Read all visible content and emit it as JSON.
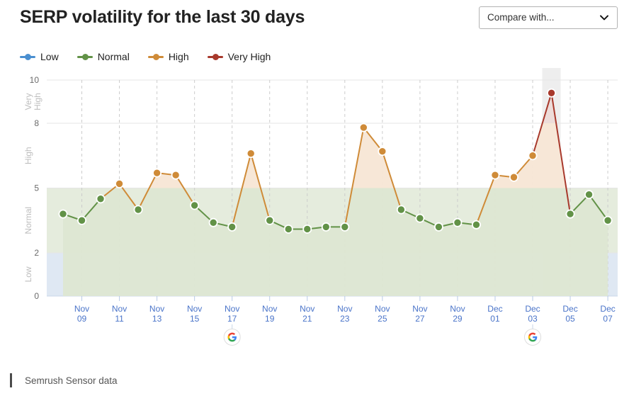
{
  "header": {
    "title": "SERP volatility for the last 30 days",
    "compare_placeholder": "Compare with...",
    "chevron_icon": "chevron-down-icon"
  },
  "legend": {
    "items": [
      {
        "label": "Low",
        "color": "#4a8fd0"
      },
      {
        "label": "Normal",
        "color": "#629247"
      },
      {
        "label": "High",
        "color": "#cf8b38"
      },
      {
        "label": "Very High",
        "color": "#a8392c"
      }
    ]
  },
  "footer": {
    "source_text": "Semrush Sensor data"
  },
  "chart_data": {
    "type": "line",
    "title": "SERP volatility for the last 30 days",
    "xlabel": "",
    "ylabel": "",
    "ylim": [
      0,
      10
    ],
    "yticks": [
      0,
      2,
      5,
      8,
      10
    ],
    "grid": true,
    "legend_position": "top-left",
    "bands": [
      {
        "name": "Low",
        "from": 0,
        "to": 2,
        "label": "Low",
        "fill": "#dbe6f2"
      },
      {
        "name": "Normal",
        "from": 2,
        "to": 5,
        "label": "Normal",
        "fill": "#e2ead9"
      },
      {
        "name": "High",
        "from": 5,
        "to": 8,
        "label": "High",
        "fill": "#ffffff"
      },
      {
        "name": "Very High",
        "from": 8,
        "to": 10,
        "label": "Very High",
        "fill": "#ffffff"
      }
    ],
    "xtick_labels": [
      "Nov 09",
      "Nov 11",
      "Nov 13",
      "Nov 15",
      "Nov 17",
      "Nov 19",
      "Nov 21",
      "Nov 23",
      "Nov 25",
      "Nov 27",
      "Nov 29",
      "Dec 01",
      "Dec 03",
      "Dec 05",
      "Dec 07"
    ],
    "x": [
      "Nov 08",
      "Nov 09",
      "Nov 10",
      "Nov 11",
      "Nov 12",
      "Nov 13",
      "Nov 14",
      "Nov 15",
      "Nov 16",
      "Nov 17",
      "Nov 18",
      "Nov 19",
      "Nov 20",
      "Nov 21",
      "Nov 22",
      "Nov 23",
      "Nov 24",
      "Nov 25",
      "Nov 26",
      "Nov 27",
      "Nov 28",
      "Nov 29",
      "Nov 30",
      "Dec 01",
      "Dec 02",
      "Dec 03",
      "Dec 04",
      "Dec 05",
      "Dec 06",
      "Dec 07"
    ],
    "values": [
      3.8,
      3.5,
      4.5,
      5.2,
      4.0,
      5.7,
      5.6,
      4.2,
      3.4,
      3.2,
      6.6,
      3.5,
      3.1,
      3.1,
      3.2,
      3.2,
      7.8,
      6.7,
      4.0,
      3.6,
      3.2,
      3.4,
      3.3,
      5.6,
      5.5,
      6.5,
      9.4,
      3.8,
      4.7,
      3.5
    ],
    "point_levels": [
      "Normal",
      "Normal",
      "Normal",
      "High",
      "Normal",
      "High",
      "High",
      "Normal",
      "Normal",
      "Normal",
      "High",
      "Normal",
      "Normal",
      "Normal",
      "Normal",
      "Normal",
      "High",
      "High",
      "Normal",
      "Normal",
      "Normal",
      "Normal",
      "Normal",
      "High",
      "High",
      "High",
      "Very High",
      "Normal",
      "Normal",
      "Normal"
    ],
    "highlight_band": {
      "x": "Dec 04",
      "color": "#e8e8e8"
    },
    "google_update_markers": [
      {
        "x": "Nov 17",
        "icon": "google-icon"
      },
      {
        "x": "Dec 03",
        "icon": "google-icon"
      }
    ],
    "colors": {
      "low": "#4a8fd0",
      "normal": "#629247",
      "high": "#cf8b38",
      "very_high": "#a8392c",
      "normal_area": "#dde7d2",
      "high_area": "#f7e6d5",
      "very_high_area": "#ecd9d6",
      "low_area": "#dbe6f2"
    }
  }
}
